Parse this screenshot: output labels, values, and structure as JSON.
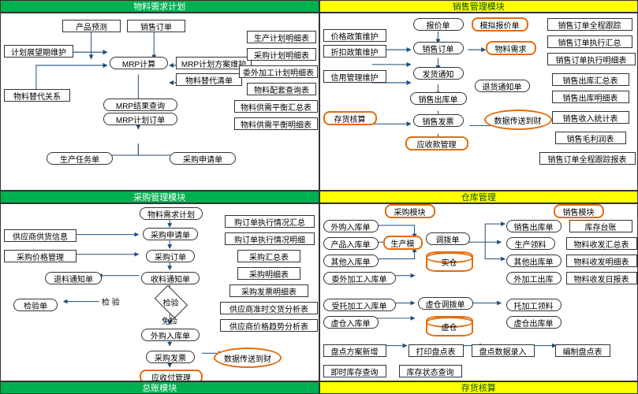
{
  "titles": {
    "q1": "物料需求计划",
    "q2": "销售管理模块",
    "q3": "采购管理模块",
    "q4": "仓库管理",
    "b1": "总账模块",
    "b2": "存货核算"
  },
  "q1": {
    "product_forecast": "产品预测",
    "sales_order": "销售订单",
    "plan_horizon": "计划展望期维护",
    "mrp_calc": "MRP计算",
    "mrp_plan_maint": "MRP计划方案维护",
    "mat_sub_close": "物料替代清单",
    "mat_sub_rel": "物料替代关系",
    "mrp_result_query": "MRP结果查询",
    "mrp_plan_order": "MRP计划订单",
    "prod_task": "生产任务单",
    "purchase_req": "采购申请单",
    "side": {
      "prod_plan_detail": "生产计划明细表",
      "purchase_plan_detail": "采购计划明细表",
      "outsource_plan_detail": "委外加工计划明细表",
      "mat_set_close": "物料配套查询表",
      "supply_balance_sum": "物料供需平衡汇总表",
      "supply_balance_detail": "物料供需平衡明细表"
    }
  },
  "q2": {
    "left": {
      "price_policy": "价格政策维护",
      "discount_policy": "折扣政策维护",
      "credit_mgmt": "信用管理维护",
      "inv_cost": "存货核算"
    },
    "mid": {
      "quote": "报价单",
      "sim_quote": "模拟报价单",
      "sales_order": "销售订单",
      "mat_demand": "物料需求",
      "delivery_notice": "发货通知",
      "return_notice": "退货通知单",
      "sales_out": "销售出库单",
      "sales_invoice": "销售发票",
      "receivable_mgmt": "应收款管理",
      "to_finance": "数据传送到财"
    },
    "right": {
      "order_track": "销售订单全程跟踪",
      "order_exec_sum": "销售订单执行汇总",
      "order_exec_detail": "销售订单执行明细表",
      "out_sum": "销售出库汇总表",
      "out_detail": "销售出库明细表",
      "income_stat": "销售收入统计表",
      "gross_margin": "销售毛利润表",
      "order_track_report": "销售订单全程跟踪报表"
    }
  },
  "q3": {
    "left": {
      "supplier_info": "供应商供货信息",
      "purchase_price_mgmt": "采购价格管理",
      "return_notice": "退料通知单",
      "inspect_sheet": "检验单"
    },
    "mid": {
      "mat_demand_plan": "物料需求计划",
      "purchase_req": "采购申请单",
      "purchase_order": "采购订单",
      "receipt_notice": "收料通知单",
      "inspect": "检 验",
      "inspect_node": "检验",
      "no_inspect": "免检",
      "purchase_in": "外购入库单",
      "purchase_invoice": "采购发票",
      "payable_mgmt": "应收付管理",
      "to_finance": "数据传送到财"
    },
    "right": {
      "order_exec_sum": "购订单执行情况汇总",
      "order_exec_detail": "购订单执行情况明细",
      "purchase_sum": "采购汇总表",
      "purchase_detail": "采购明细表",
      "invoice_detail": "采购发票明细表",
      "supplier_delivery": "供应商准时交货分析表",
      "supplier_price_trend": "供应商价格趋势分析表"
    }
  },
  "q4": {
    "headers": {
      "purchase_mod": "采购模块",
      "prod_mod": "生产模",
      "sales_mod": "销售模块"
    },
    "left": {
      "purchase_in": "外购入库单",
      "prod_in": "产品入库单",
      "other_in": "其他入库单",
      "outsource_in": "委外加工入库单",
      "consign_in": "受托加工入库单",
      "virtual_in": "虚仓入库单",
      "plan_new": "盘点方案新增",
      "plan_query": "即时库存查询"
    },
    "mid": {
      "transfer": "调拨单",
      "real_wh": "实仓",
      "virtual_transfer": "虚仓调拨单",
      "virtual_wh": "虚仓",
      "print_plan": "打印盘点表",
      "data_entry": "盘点数据录入",
      "stock_status": "库存状态查询"
    },
    "right": {
      "sales_out": "销售出库单",
      "prod_issue": "生产领料",
      "other_out": "其他出库单",
      "outsource_out": "外加工出库",
      "consign_issue": "托加工领料",
      "virtual_out": "虚仓出库单",
      "compile_plan": "编制盘点表"
    },
    "far": {
      "stock_ledger": "库存台账",
      "txn_sum": "物料收发汇总表",
      "txn_detail": "物料收发明细表",
      "txn_daily": "物料收发日报表"
    }
  }
}
